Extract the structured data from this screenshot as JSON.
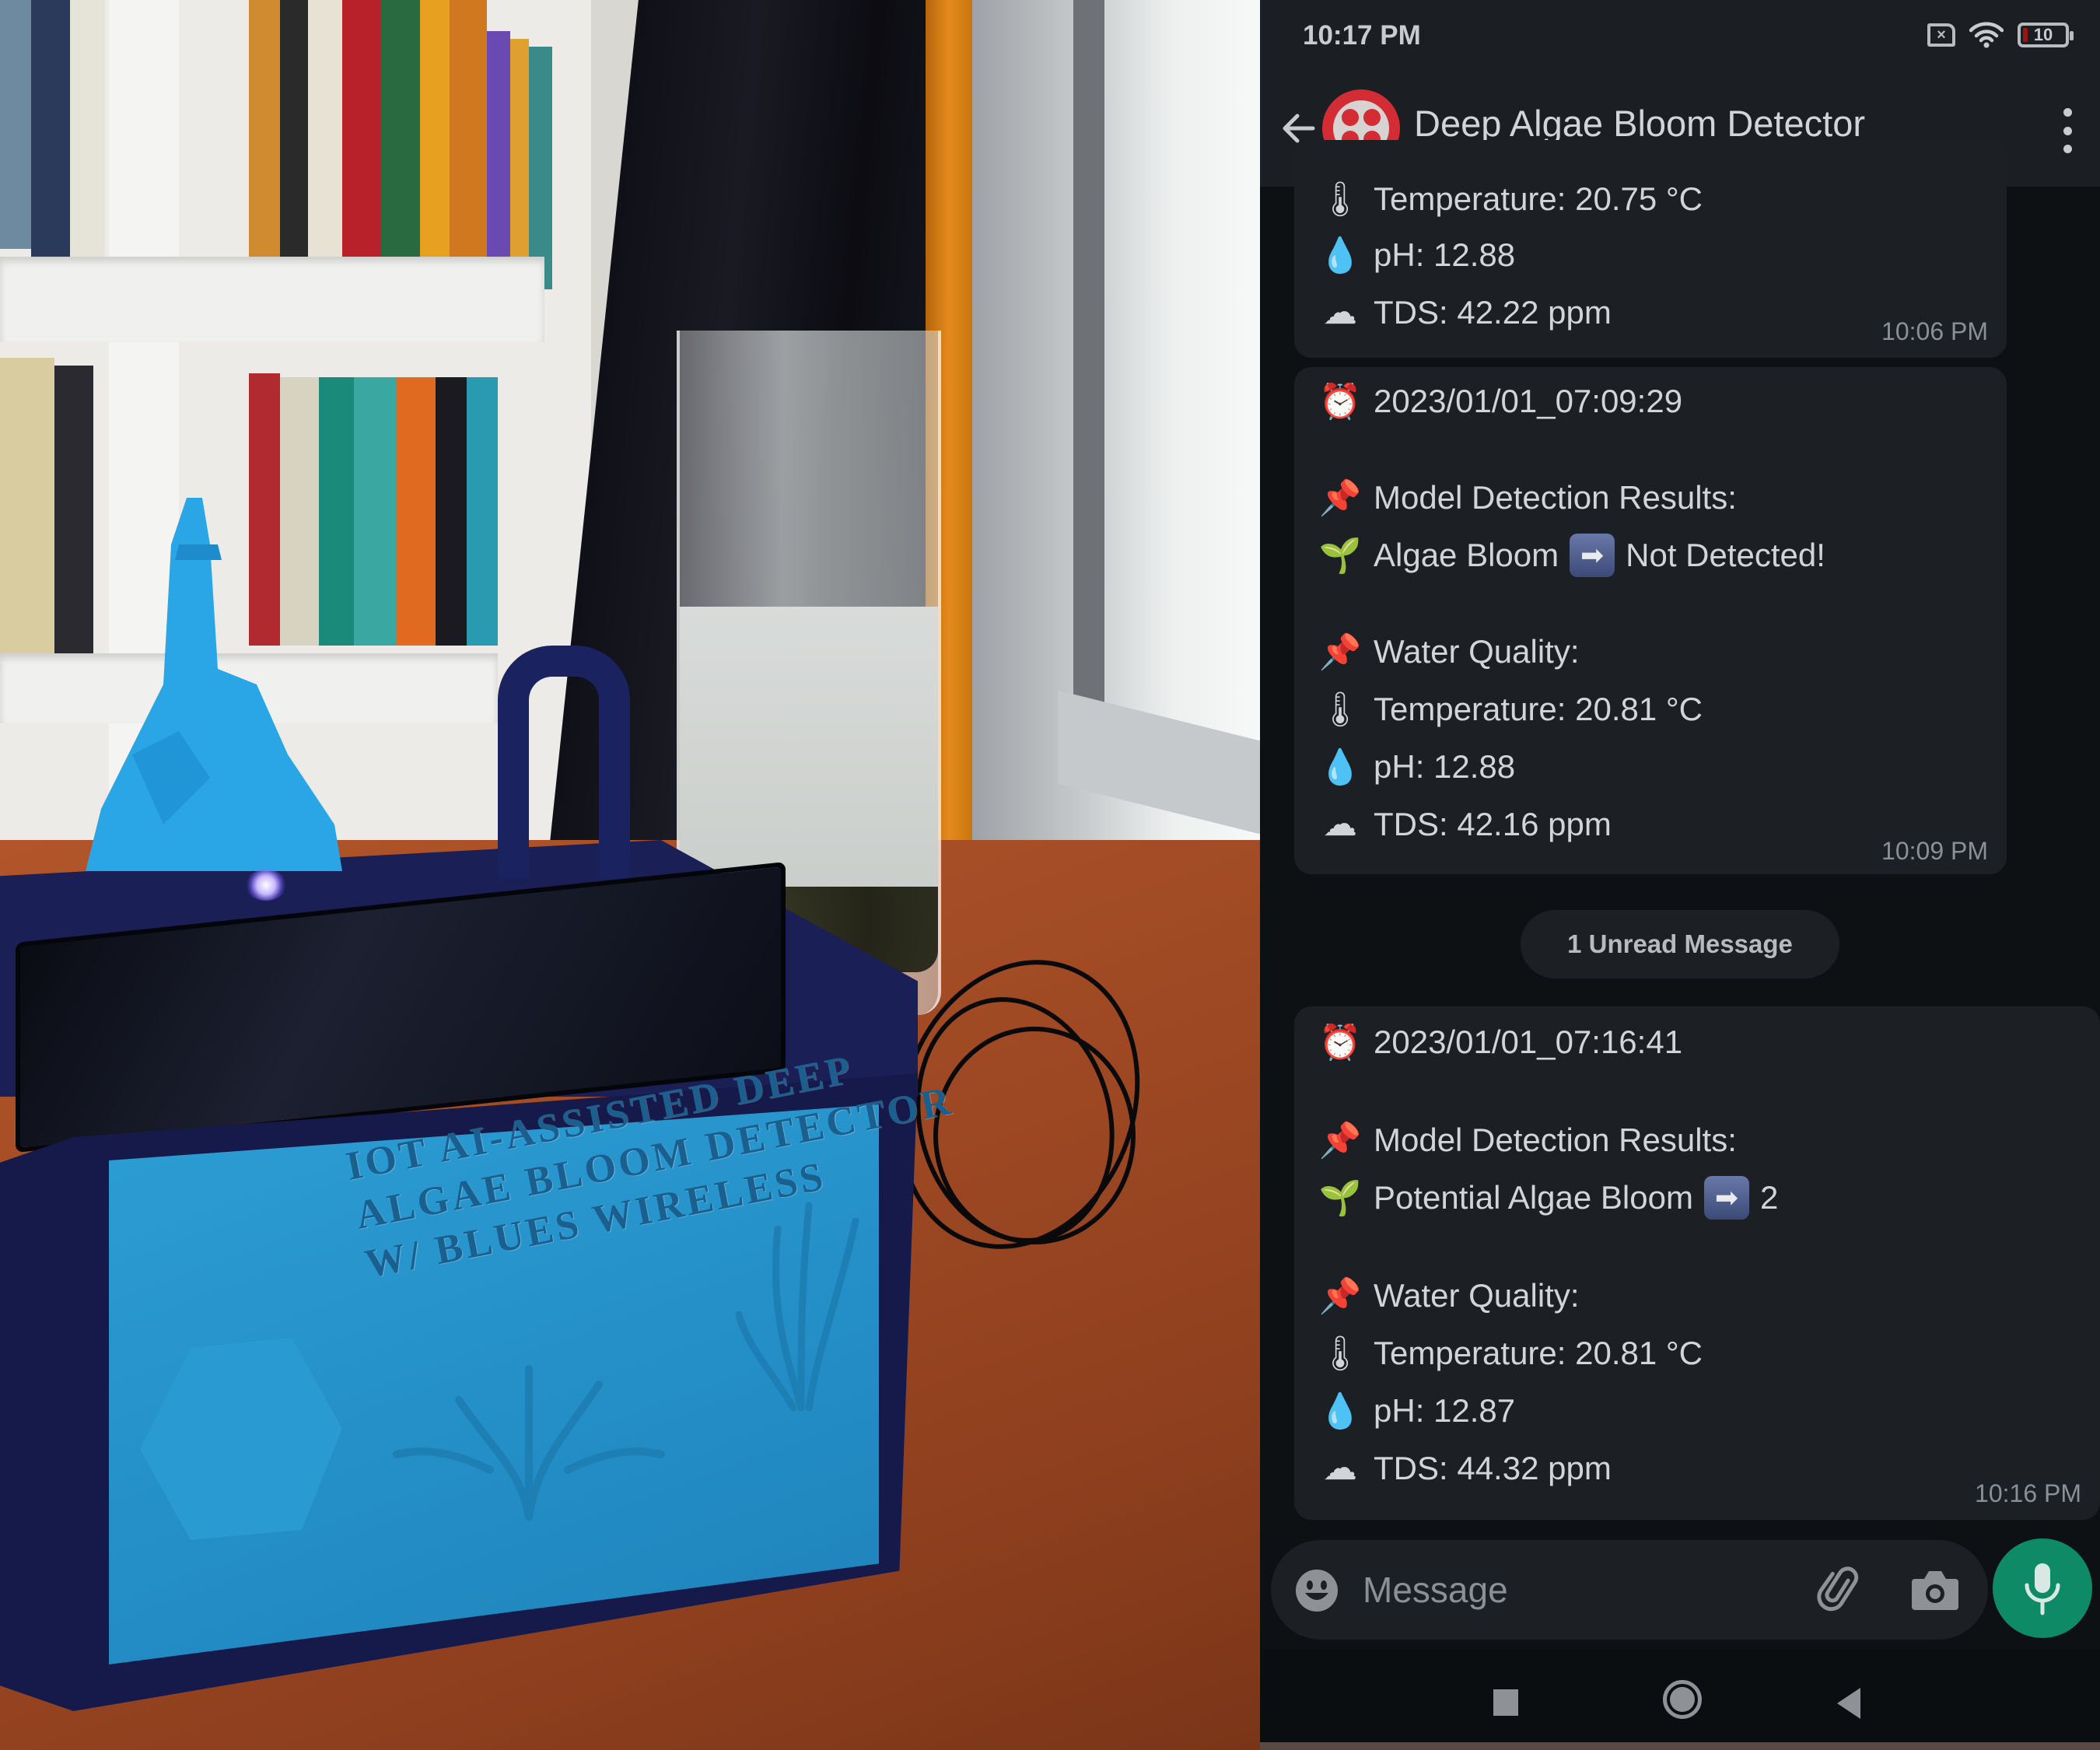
{
  "photo": {
    "description": "Photo of 3D-printed algae bloom detector device",
    "engraving_lines": [
      "IOT AI-ASSISTED DEEP",
      "ALGAE BLOOM DETECTOR",
      "W/ BLUES WIRELESS"
    ]
  },
  "status_bar": {
    "time": "10:17 PM",
    "sim_icon": "no-sim-icon",
    "wifi_icon": "wifi-icon",
    "battery_level": "10",
    "battery_fraction": 0.1
  },
  "header": {
    "back_icon": "arrow-left-icon",
    "avatar_icon": "twilio-logo-icon",
    "title": "Deep Algae Bloom Detector",
    "menu_icon": "more-vertical-icon"
  },
  "messages": [
    {
      "partial": true,
      "lines": [
        {
          "icon": "thermometer",
          "emoji": "🌡",
          "text": "Temperature: 20.75 °C"
        },
        {
          "icon": "droplet",
          "emoji": "💧",
          "text": "pH: 12.88"
        },
        {
          "icon": "cloud",
          "emoji": "☁",
          "text": "TDS: 42.22  ppm"
        }
      ],
      "time": "10:06 PM"
    },
    {
      "timestamp": {
        "icon": "alarm-clock",
        "emoji": "⏰",
        "text": "2023/01/01_07:09:29"
      },
      "detection_header": {
        "icon": "pushpin",
        "emoji": "📌",
        "text": "Model Detection Results:"
      },
      "detection_result": {
        "icon": "seedling",
        "emoji": "🌱",
        "label": "Algae Bloom",
        "arrow": "➡",
        "value": "Not Detected!"
      },
      "quality_header": {
        "icon": "pushpin",
        "emoji": "📌",
        "text": "Water Quality:"
      },
      "lines": [
        {
          "icon": "thermometer",
          "emoji": "🌡",
          "text": "Temperature: 20.81 °C"
        },
        {
          "icon": "droplet",
          "emoji": "💧",
          "text": "pH: 12.88"
        },
        {
          "icon": "cloud",
          "emoji": "☁",
          "text": "TDS: 42.16  ppm"
        }
      ],
      "time": "10:09 PM"
    },
    {
      "timestamp": {
        "icon": "alarm-clock",
        "emoji": "⏰",
        "text": "2023/01/01_07:16:41"
      },
      "detection_header": {
        "icon": "pushpin",
        "emoji": "📌",
        "text": "Model Detection Results:"
      },
      "detection_result": {
        "icon": "seedling",
        "emoji": "🌱",
        "label": "Potential Algae Bloom",
        "arrow": "➡",
        "value": "2"
      },
      "quality_header": {
        "icon": "pushpin",
        "emoji": "📌",
        "text": "Water Quality:"
      },
      "lines": [
        {
          "icon": "thermometer",
          "emoji": "🌡",
          "text": "Temperature: 20.81 °C"
        },
        {
          "icon": "droplet",
          "emoji": "💧",
          "text": "pH: 12.87"
        },
        {
          "icon": "cloud",
          "emoji": "☁",
          "text": "TDS: 44.32  ppm"
        }
      ],
      "time": "10:16 PM"
    }
  ],
  "unread_label": "1 Unread Message",
  "composer": {
    "placeholder": "Message",
    "value": "",
    "emoji_icon": "smiley-icon",
    "attach_icon": "paperclip-icon",
    "camera_icon": "camera-icon",
    "mic_icon": "microphone-icon"
  },
  "nav": {
    "recents_icon": "square-icon",
    "home_icon": "circle-icon",
    "back_icon": "triangle-back-icon"
  },
  "colors": {
    "header_bg": "#1b1f23",
    "bubble_bg": "#1c2024",
    "chat_bg": "#0d1114",
    "mic_green": "#0f8a66",
    "avatar_red": "#d42c34",
    "text_primary": "#d2d5d8",
    "text_secondary": "#8a9096"
  }
}
